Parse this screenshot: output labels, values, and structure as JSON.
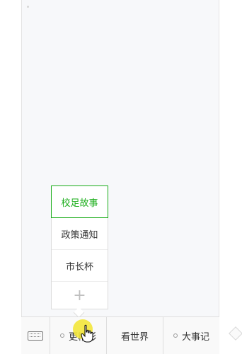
{
  "submenu": {
    "items": [
      "校足故事",
      "政策通知",
      "市长杯"
    ],
    "add_label": "+"
  },
  "bottom_menu": {
    "items": [
      {
        "label": "更精彩"
      },
      {
        "label": "看世界"
      },
      {
        "label": "大事记"
      }
    ]
  },
  "colors": {
    "active": "#1aad19",
    "highlight": "#f2e63a"
  }
}
